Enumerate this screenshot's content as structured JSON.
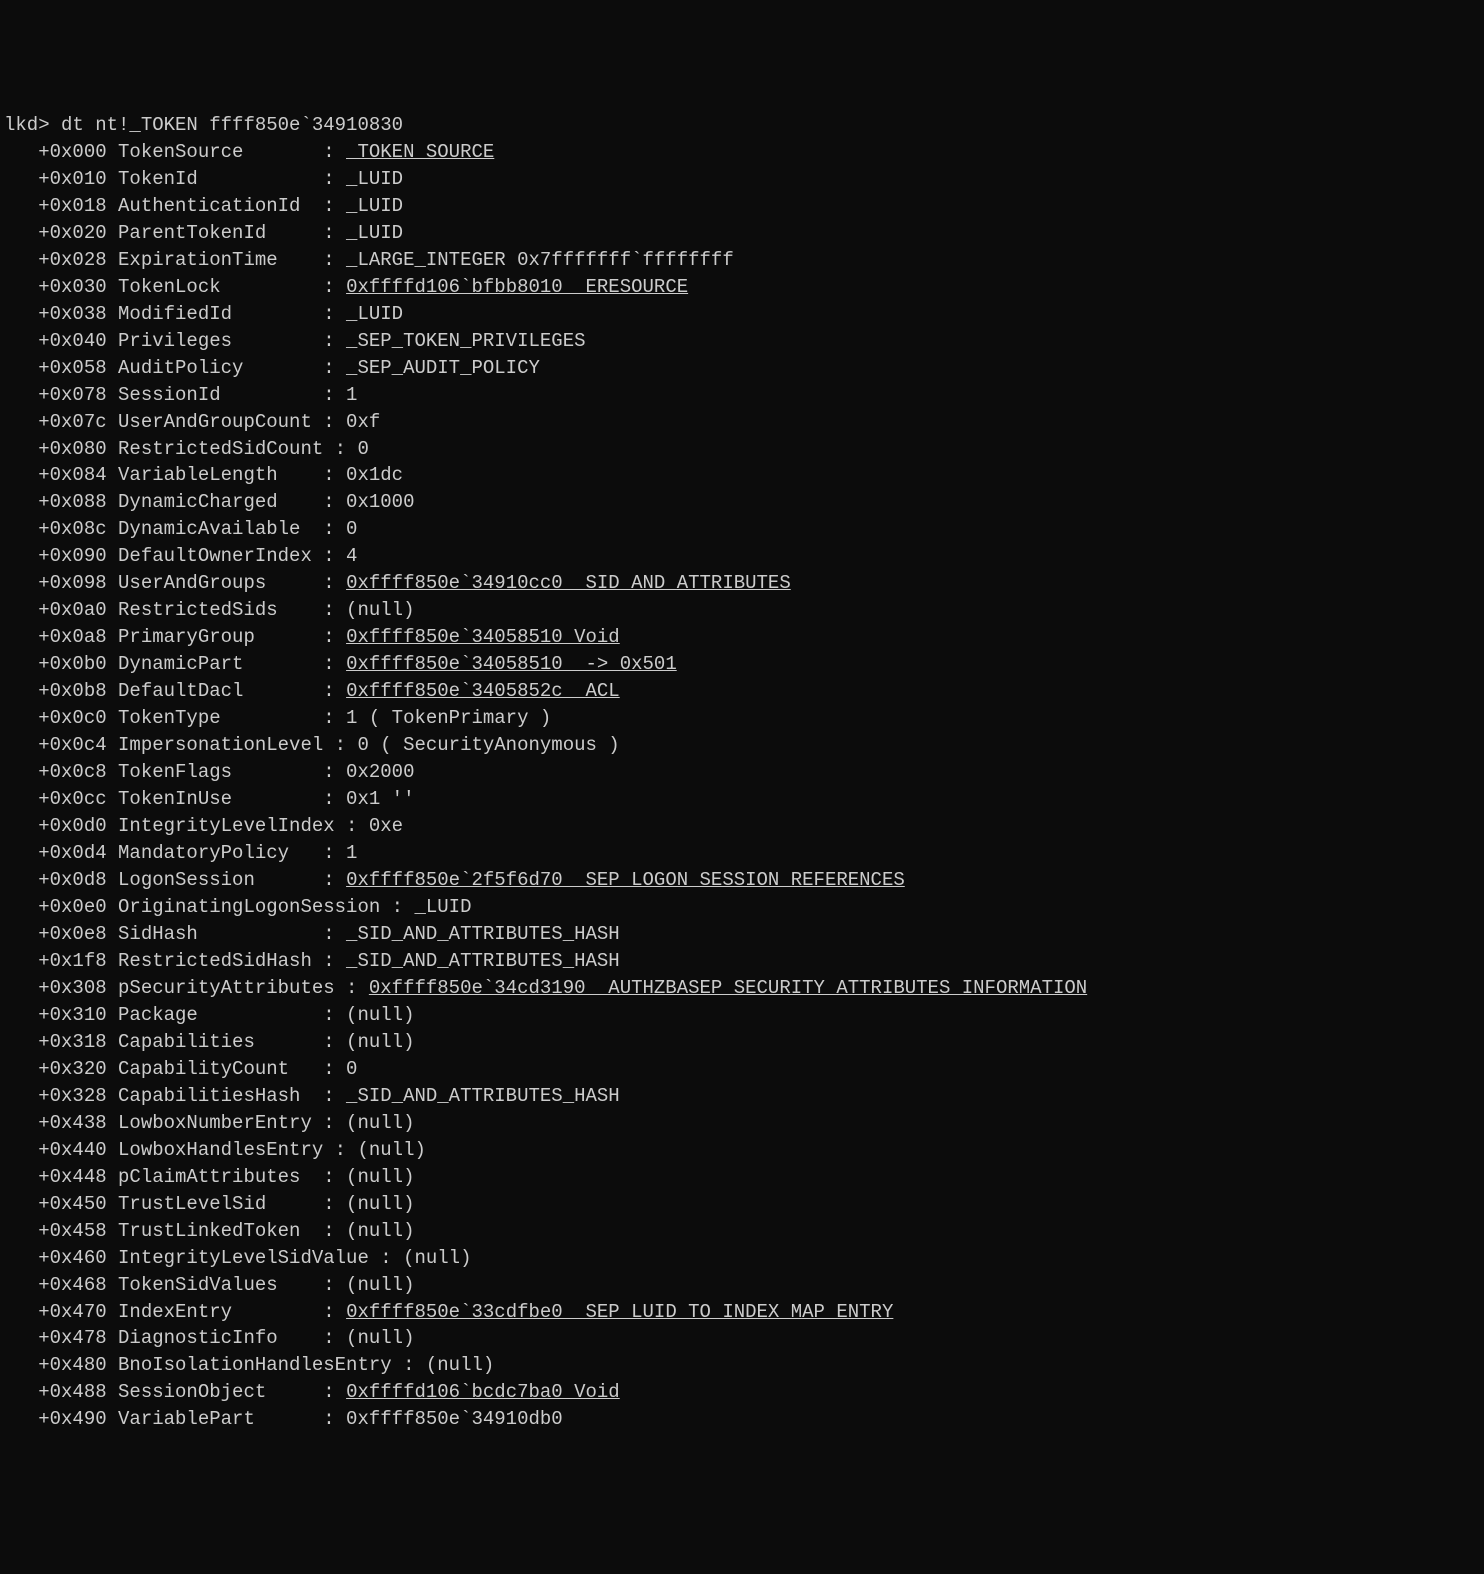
{
  "prompt": "lkd> dt nt!_TOKEN ffff850e`34910830",
  "fields": [
    {
      "offset": "+0x000",
      "name": "TokenSource",
      "value": "_TOKEN_SOURCE",
      "link": true,
      "pad": 17
    },
    {
      "offset": "+0x010",
      "name": "TokenId",
      "value": "_LUID",
      "pad": 17
    },
    {
      "offset": "+0x018",
      "name": "AuthenticationId",
      "value": "_LUID",
      "pad": 17
    },
    {
      "offset": "+0x020",
      "name": "ParentTokenId",
      "value": "_LUID",
      "pad": 17
    },
    {
      "offset": "+0x028",
      "name": "ExpirationTime",
      "value": "_LARGE_INTEGER 0x7fffffff`ffffffff",
      "pad": 17
    },
    {
      "offset": "+0x030",
      "name": "TokenLock",
      "value": "0xffffd106`bfbb8010 _ERESOURCE",
      "link": true,
      "pad": 17
    },
    {
      "offset": "+0x038",
      "name": "ModifiedId",
      "value": "_LUID",
      "pad": 17
    },
    {
      "offset": "+0x040",
      "name": "Privileges",
      "value": "_SEP_TOKEN_PRIVILEGES",
      "pad": 17
    },
    {
      "offset": "+0x058",
      "name": "AuditPolicy",
      "value": "_SEP_AUDIT_POLICY",
      "pad": 17
    },
    {
      "offset": "+0x078",
      "name": "SessionId",
      "value": "1",
      "pad": 17
    },
    {
      "offset": "+0x07c",
      "name": "UserAndGroupCount",
      "value": "0xf",
      "pad": 17,
      "nopad_name": true
    },
    {
      "offset": "+0x080",
      "name": "RestrictedSidCount",
      "value": "0",
      "pad": 18,
      "nopad_name": true
    },
    {
      "offset": "+0x084",
      "name": "VariableLength",
      "value": "0x1dc",
      "pad": 17
    },
    {
      "offset": "+0x088",
      "name": "DynamicCharged",
      "value": "0x1000",
      "pad": 17
    },
    {
      "offset": "+0x08c",
      "name": "DynamicAvailable",
      "value": "0",
      "pad": 17
    },
    {
      "offset": "+0x090",
      "name": "DefaultOwnerIndex",
      "value": "4",
      "pad": 17,
      "nopad_name": true
    },
    {
      "offset": "+0x098",
      "name": "UserAndGroups",
      "value": "0xffff850e`34910cc0 _SID_AND_ATTRIBUTES",
      "link": true,
      "pad": 17
    },
    {
      "offset": "+0x0a0",
      "name": "RestrictedSids",
      "value": "(null) ",
      "pad": 17
    },
    {
      "offset": "+0x0a8",
      "name": "PrimaryGroup",
      "value": "0xffff850e`34058510 Void",
      "link": true,
      "pad": 17
    },
    {
      "offset": "+0x0b0",
      "name": "DynamicPart",
      "value": "0xffff850e`34058510  -> 0x501",
      "link": true,
      "pad": 17
    },
    {
      "offset": "+0x0b8",
      "name": "DefaultDacl",
      "value": "0xffff850e`3405852c _ACL",
      "link": true,
      "pad": 17
    },
    {
      "offset": "+0x0c0",
      "name": "TokenType",
      "value": "1 ( TokenPrimary )",
      "pad": 17
    },
    {
      "offset": "+0x0c4",
      "name": "ImpersonationLevel",
      "value": "0 ( SecurityAnonymous )",
      "pad": 18,
      "nopad_name": true
    },
    {
      "offset": "+0x0c8",
      "name": "TokenFlags",
      "value": "0x2000",
      "pad": 17
    },
    {
      "offset": "+0x0cc",
      "name": "TokenInUse",
      "value": "0x1 ''",
      "pad": 17
    },
    {
      "offset": "+0x0d0",
      "name": "IntegrityLevelIndex",
      "value": "0xe",
      "pad": 19,
      "nopad_name": true
    },
    {
      "offset": "+0x0d4",
      "name": "MandatoryPolicy",
      "value": "1",
      "pad": 17
    },
    {
      "offset": "+0x0d8",
      "name": "LogonSession",
      "value": "0xffff850e`2f5f6d70 _SEP_LOGON_SESSION_REFERENCES",
      "link": true,
      "pad": 17
    },
    {
      "offset": "+0x0e0",
      "name": "OriginatingLogonSession",
      "value": "_LUID",
      "pad": 23,
      "nopad_name": true
    },
    {
      "offset": "+0x0e8",
      "name": "SidHash",
      "value": "_SID_AND_ATTRIBUTES_HASH",
      "pad": 17
    },
    {
      "offset": "+0x1f8",
      "name": "RestrictedSidHash",
      "value": "_SID_AND_ATTRIBUTES_HASH",
      "pad": 17,
      "nopad_name": true
    },
    {
      "offset": "+0x308",
      "name": "pSecurityAttributes",
      "value": "0xffff850e`34cd3190 _AUTHZBASEP_SECURITY_ATTRIBUTES_INFORMATION",
      "link": true,
      "pad": 19,
      "nopad_name": true
    },
    {
      "offset": "+0x310",
      "name": "Package",
      "value": "(null) ",
      "pad": 17
    },
    {
      "offset": "+0x318",
      "name": "Capabilities",
      "value": "(null) ",
      "pad": 17
    },
    {
      "offset": "+0x320",
      "name": "CapabilityCount",
      "value": "0",
      "pad": 17
    },
    {
      "offset": "+0x328",
      "name": "CapabilitiesHash",
      "value": "_SID_AND_ATTRIBUTES_HASH",
      "pad": 17
    },
    {
      "offset": "+0x438",
      "name": "LowboxNumberEntry",
      "value": "(null) ",
      "pad": 17,
      "nopad_name": true
    },
    {
      "offset": "+0x440",
      "name": "LowboxHandlesEntry",
      "value": "(null) ",
      "pad": 18,
      "nopad_name": true
    },
    {
      "offset": "+0x448",
      "name": "pClaimAttributes",
      "value": "(null) ",
      "pad": 17
    },
    {
      "offset": "+0x450",
      "name": "TrustLevelSid",
      "value": "(null) ",
      "pad": 17
    },
    {
      "offset": "+0x458",
      "name": "TrustLinkedToken",
      "value": "(null) ",
      "pad": 17
    },
    {
      "offset": "+0x460",
      "name": "IntegrityLevelSidValue",
      "value": "(null) ",
      "pad": 22,
      "nopad_name": true
    },
    {
      "offset": "+0x468",
      "name": "TokenSidValues",
      "value": "(null) ",
      "pad": 17
    },
    {
      "offset": "+0x470",
      "name": "IndexEntry",
      "value": "0xffff850e`33cdfbe0 _SEP_LUID_TO_INDEX_MAP_ENTRY",
      "link": true,
      "pad": 17
    },
    {
      "offset": "+0x478",
      "name": "DiagnosticInfo",
      "value": "(null) ",
      "pad": 17
    },
    {
      "offset": "+0x480",
      "name": "BnoIsolationHandlesEntry",
      "value": "(null) ",
      "pad": 24,
      "nopad_name": true
    },
    {
      "offset": "+0x488",
      "name": "SessionObject",
      "value": "0xffffd106`bcdc7ba0 Void",
      "link": true,
      "pad": 17
    },
    {
      "offset": "+0x490",
      "name": "VariablePart",
      "value": "0xffff850e`34910db0",
      "pad": 17
    }
  ]
}
